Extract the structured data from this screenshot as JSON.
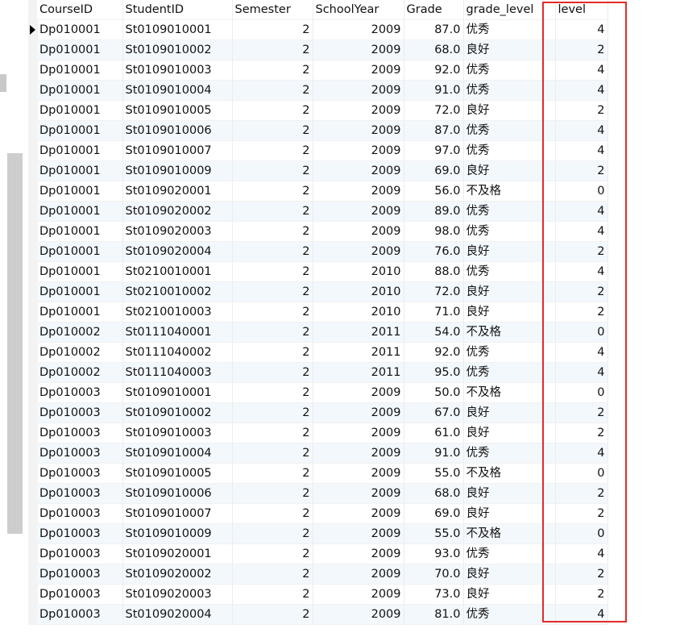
{
  "columns": [
    "CourseID",
    "StudentID",
    "Semester",
    "SchoolYear",
    "Grade",
    "grade_level",
    "level"
  ],
  "rows": [
    [
      "Dp010001",
      "St0109010001",
      "2",
      "2009",
      "87.0",
      "优秀",
      "4"
    ],
    [
      "Dp010001",
      "St0109010002",
      "2",
      "2009",
      "68.0",
      "良好",
      "2"
    ],
    [
      "Dp010001",
      "St0109010003",
      "2",
      "2009",
      "92.0",
      "优秀",
      "4"
    ],
    [
      "Dp010001",
      "St0109010004",
      "2",
      "2009",
      "91.0",
      "优秀",
      "4"
    ],
    [
      "Dp010001",
      "St0109010005",
      "2",
      "2009",
      "72.0",
      "良好",
      "2"
    ],
    [
      "Dp010001",
      "St0109010006",
      "2",
      "2009",
      "87.0",
      "优秀",
      "4"
    ],
    [
      "Dp010001",
      "St0109010007",
      "2",
      "2009",
      "97.0",
      "优秀",
      "4"
    ],
    [
      "Dp010001",
      "St0109010009",
      "2",
      "2009",
      "69.0",
      "良好",
      "2"
    ],
    [
      "Dp010001",
      "St0109020001",
      "2",
      "2009",
      "56.0",
      "不及格",
      "0"
    ],
    [
      "Dp010001",
      "St0109020002",
      "2",
      "2009",
      "89.0",
      "优秀",
      "4"
    ],
    [
      "Dp010001",
      "St0109020003",
      "2",
      "2009",
      "98.0",
      "优秀",
      "4"
    ],
    [
      "Dp010001",
      "St0109020004",
      "2",
      "2009",
      "76.0",
      "良好",
      "2"
    ],
    [
      "Dp010001",
      "St0210010001",
      "2",
      "2010",
      "88.0",
      "优秀",
      "4"
    ],
    [
      "Dp010001",
      "St0210010002",
      "2",
      "2010",
      "72.0",
      "良好",
      "2"
    ],
    [
      "Dp010001",
      "St0210010003",
      "2",
      "2010",
      "71.0",
      "良好",
      "2"
    ],
    [
      "Dp010002",
      "St0111040001",
      "2",
      "2011",
      "54.0",
      "不及格",
      "0"
    ],
    [
      "Dp010002",
      "St0111040002",
      "2",
      "2011",
      "92.0",
      "优秀",
      "4"
    ],
    [
      "Dp010002",
      "St0111040003",
      "2",
      "2011",
      "95.0",
      "优秀",
      "4"
    ],
    [
      "Dp010003",
      "St0109010001",
      "2",
      "2009",
      "50.0",
      "不及格",
      "0"
    ],
    [
      "Dp010003",
      "St0109010002",
      "2",
      "2009",
      "67.0",
      "良好",
      "2"
    ],
    [
      "Dp010003",
      "St0109010003",
      "2",
      "2009",
      "61.0",
      "良好",
      "2"
    ],
    [
      "Dp010003",
      "St0109010004",
      "2",
      "2009",
      "91.0",
      "优秀",
      "4"
    ],
    [
      "Dp010003",
      "St0109010005",
      "2",
      "2009",
      "55.0",
      "不及格",
      "0"
    ],
    [
      "Dp010003",
      "St0109010006",
      "2",
      "2009",
      "68.0",
      "良好",
      "2"
    ],
    [
      "Dp010003",
      "St0109010007",
      "2",
      "2009",
      "69.0",
      "良好",
      "2"
    ],
    [
      "Dp010003",
      "St0109010009",
      "2",
      "2009",
      "55.0",
      "不及格",
      "0"
    ],
    [
      "Dp010003",
      "St0109020001",
      "2",
      "2009",
      "93.0",
      "优秀",
      "4"
    ],
    [
      "Dp010003",
      "St0109020002",
      "2",
      "2009",
      "70.0",
      "良好",
      "2"
    ],
    [
      "Dp010003",
      "St0109020003",
      "2",
      "2009",
      "73.0",
      "良好",
      "2"
    ],
    [
      "Dp010003",
      "St0109020004",
      "2",
      "2009",
      "81.0",
      "优秀",
      "4"
    ]
  ],
  "colors": {
    "highlight_box": "#e32b2b",
    "alt_row": "#f3f8fd"
  },
  "icons": {
    "current_row": "row-pointer-icon"
  }
}
